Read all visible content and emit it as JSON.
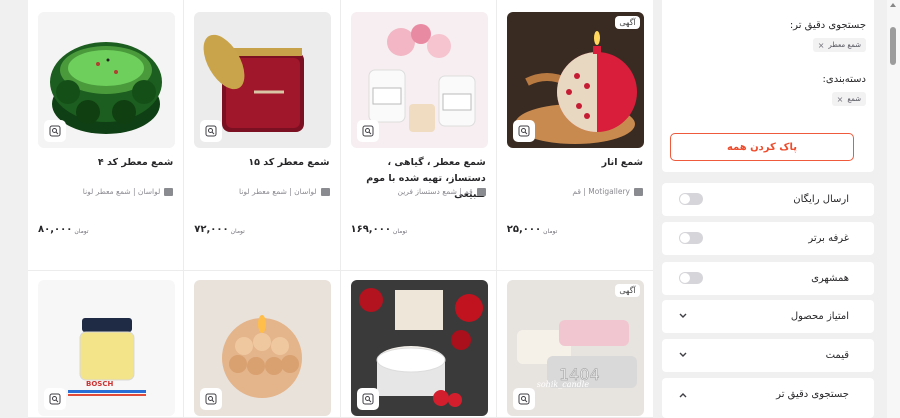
{
  "products": [
    {
      "title": "شمع انار",
      "shop": "Motigallery | قم",
      "price": "۲۵,۰۰۰",
      "ad_badge": "آگهی",
      "image_icon": "pomegranate-candle-image"
    },
    {
      "title": "شمع معطر ، گیاهی ، دستساز، تهیه شده با موم طبیعی",
      "shop": "قم | شمع دستساز فرین",
      "price": "۱۶۹,۰۰۰",
      "ad_badge": "",
      "image_icon": "scented-jar-candles-image"
    },
    {
      "title": "شمع معطر کد ۱۵",
      "shop": "لواسان | شمع معطر لونا",
      "price": "۷۲,۰۰۰",
      "ad_badge": "",
      "image_icon": "red-jar-candle-image"
    },
    {
      "title": "شمع معطر کد ۴",
      "shop": "لواسان | شمع معطر لونا",
      "price": "۸۰,۰۰۰",
      "ad_badge": "",
      "image_icon": "green-glass-candle-image"
    },
    {
      "title": "",
      "shop": "",
      "price": "",
      "ad_badge": "آگهی",
      "image_icon": "number-candles-image",
      "image_text": "sohik_candle"
    },
    {
      "title": "",
      "shop": "",
      "price": "",
      "ad_badge": "",
      "image_icon": "rose-candle-image"
    },
    {
      "title": "",
      "shop": "",
      "price": "",
      "ad_badge": "",
      "image_icon": "pinecone-candle-image"
    },
    {
      "title": "",
      "shop": "",
      "price": "",
      "ad_badge": "",
      "image_icon": "small-jar-candle-image",
      "image_text": "BOSCH"
    }
  ],
  "currency": "تومان",
  "sidebar": {
    "refine_title": "جستجوی دقیق تر:",
    "refine_chip": "شمع معطر",
    "category_title": "دسته‌بندی:",
    "category_chip": "شمع",
    "clear_all": "پاک کردن همه",
    "toggles": [
      {
        "label": "ارسال رایگان",
        "on": false
      },
      {
        "label": "غرفه برتر",
        "on": false
      },
      {
        "label": "همشهری",
        "on": false
      }
    ],
    "accordions": [
      {
        "label": "امتیاز محصول",
        "expanded": false
      },
      {
        "label": "قیمت",
        "expanded": false
      },
      {
        "label": "جستجوی دقیق تر",
        "expanded": true
      }
    ]
  },
  "colors": {
    "accent": "#ef4b2b",
    "toggle_off": "#d6d6da",
    "background": "#f0f0f1"
  }
}
